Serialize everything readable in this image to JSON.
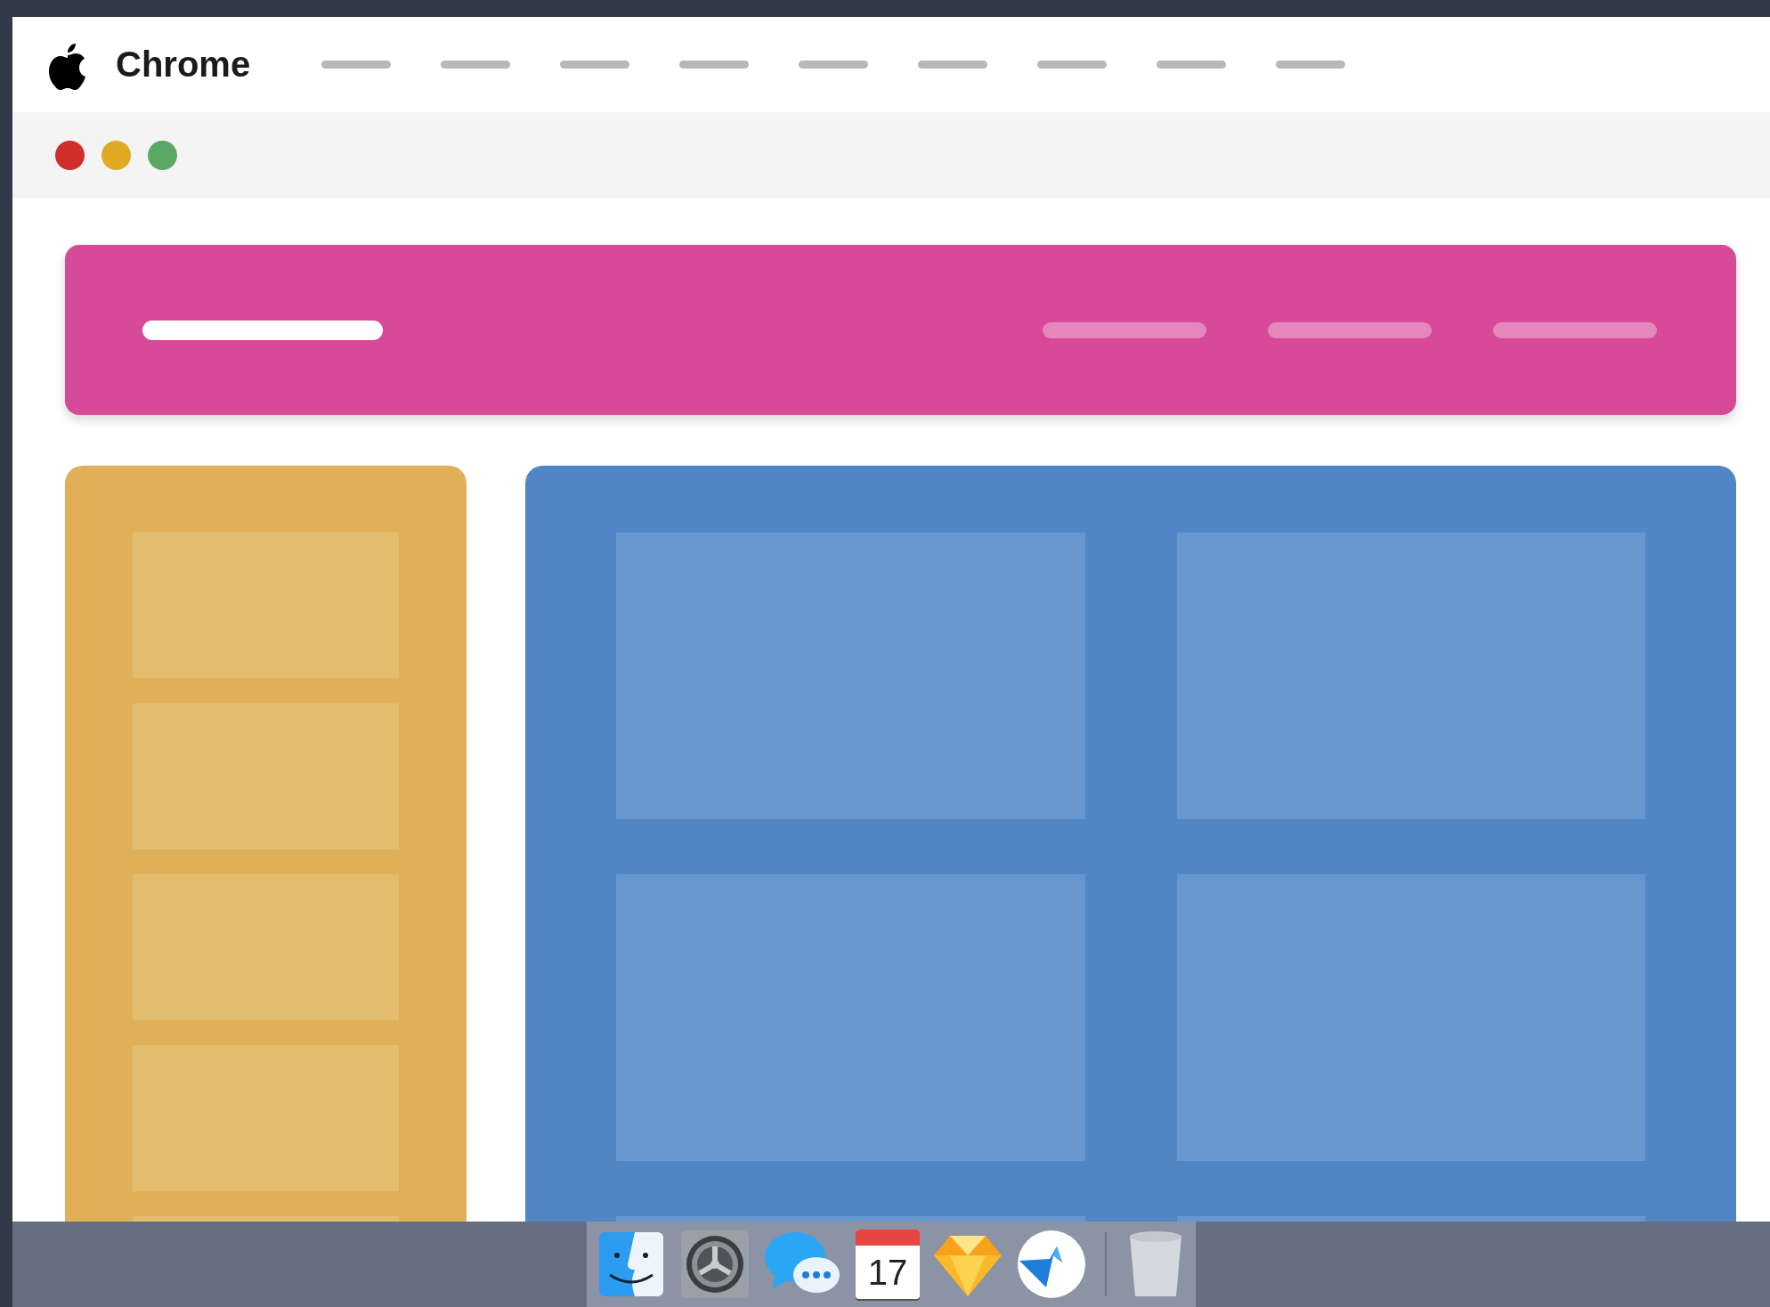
{
  "menu_bar": {
    "app_name": "Chrome",
    "menu_items": [
      {
        "kind": "placeholder"
      },
      {
        "kind": "placeholder"
      },
      {
        "kind": "placeholder"
      },
      {
        "kind": "placeholder"
      },
      {
        "kind": "placeholder"
      },
      {
        "kind": "placeholder"
      },
      {
        "kind": "placeholder"
      },
      {
        "kind": "placeholder"
      },
      {
        "kind": "placeholder"
      }
    ]
  },
  "window_controls": [
    {
      "color": "#cf2e2a"
    },
    {
      "color": "#e0aa22"
    },
    {
      "color": "#5ba865"
    }
  ],
  "header": {
    "logo": {
      "kind": "placeholder"
    },
    "nav_items": [
      {
        "kind": "placeholder"
      },
      {
        "kind": "placeholder"
      },
      {
        "kind": "placeholder"
      }
    ]
  },
  "sidebar": {
    "tiles": [
      {
        "kind": "tile"
      },
      {
        "kind": "tile"
      },
      {
        "kind": "tile"
      },
      {
        "kind": "tile"
      },
      {
        "kind": "tile"
      }
    ]
  },
  "main": {
    "tiles": [
      {
        "kind": "tile"
      },
      {
        "kind": "tile"
      },
      {
        "kind": "tile"
      },
      {
        "kind": "tile"
      },
      {
        "kind": "tile"
      },
      {
        "kind": "tile"
      }
    ]
  },
  "dock": [
    {
      "kind": "finder"
    },
    {
      "kind": "settings"
    },
    {
      "kind": "messages"
    },
    {
      "kind": "calendar",
      "day": "17"
    },
    {
      "kind": "sketch"
    },
    {
      "kind": "bird"
    },
    {
      "kind": "separator"
    },
    {
      "kind": "trash"
    }
  ]
}
